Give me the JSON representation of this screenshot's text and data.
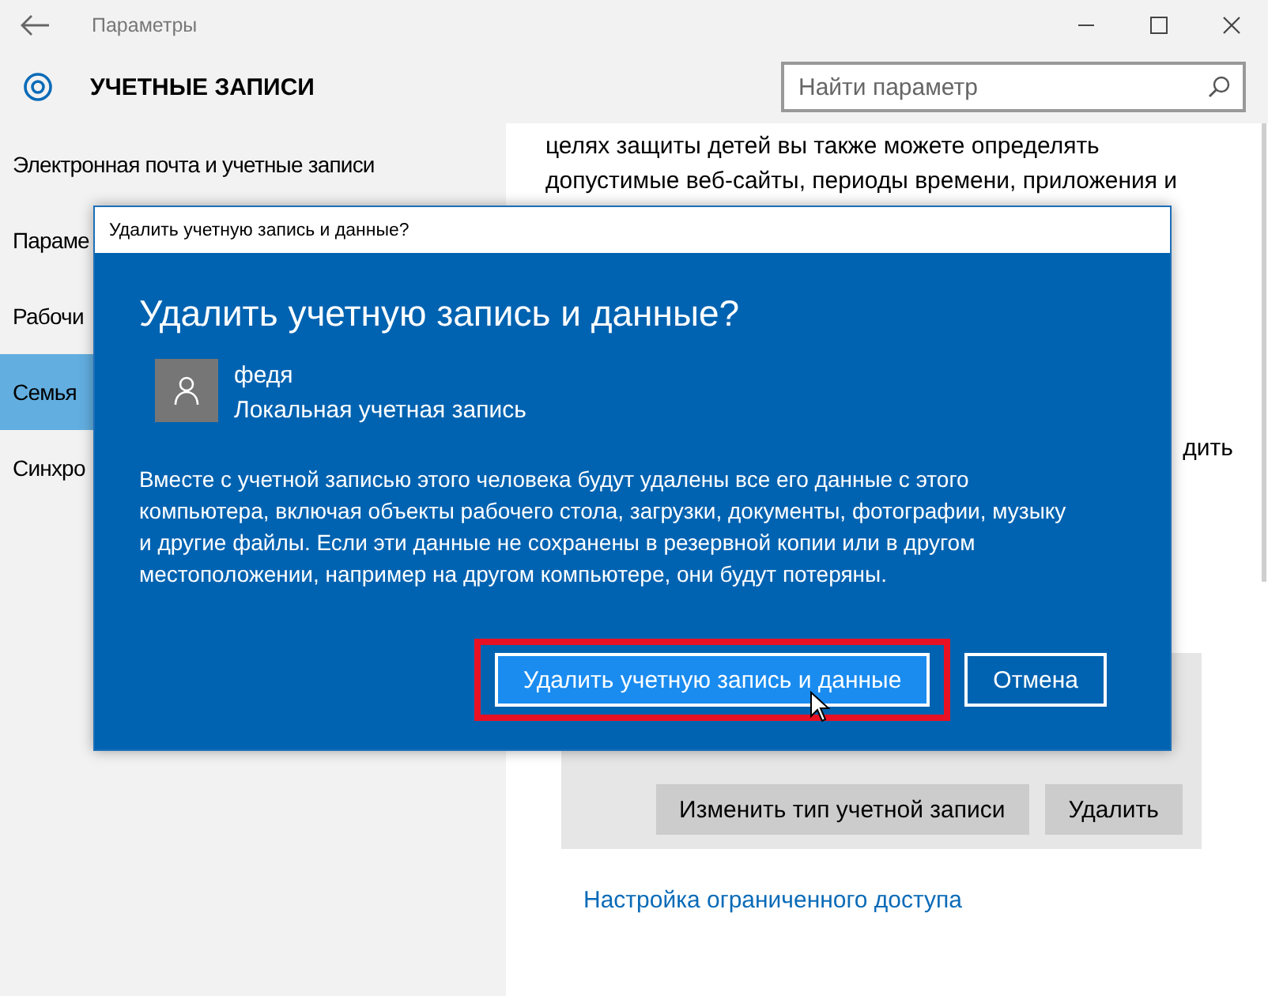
{
  "window": {
    "title": "Параметры"
  },
  "header": {
    "title": "УЧЕТНЫЕ ЗАПИСИ",
    "search": {
      "placeholder": "Найти параметр"
    }
  },
  "sidebar": {
    "items": [
      {
        "label": "Электронная почта и учетные записи",
        "selected": false
      },
      {
        "label": "Параме",
        "selected": false
      },
      {
        "label": "Рабочи",
        "selected": false
      },
      {
        "label": "Семья",
        "selected": true
      },
      {
        "label": "Синхро",
        "selected": false
      }
    ]
  },
  "content": {
    "text_lines": [
      "целях защиты детей вы также можете определять",
      "допустимые веб-сайты, периоды времени, приложения и"
    ],
    "partial_text": "дить",
    "buttons": [
      "Изменить тип учетной записи",
      "Удалить"
    ],
    "link": "Настройка ограниченного доступа"
  },
  "dialog": {
    "title": "Удалить учетную запись и данные?",
    "heading": "Удалить учетную запись и данные?",
    "user": {
      "name": "федя",
      "account_type": "Локальная учетная запись"
    },
    "message": "Вместе с учетной записью этого человека будут удалены все его данные с этого компьютера, включая объекты рабочего стола, загрузки, документы, фотографии, музыку и другие файлы. Если эти данные не сохранены в резервной копии или в другом местоположении, например на другом компьютере, они будут потеряны.",
    "buttons": [
      {
        "label": "Удалить учетную запись и данные",
        "kind": "primary",
        "highlighted": true
      },
      {
        "label": "Отмена",
        "kind": "secondary",
        "highlighted": false
      }
    ]
  }
}
